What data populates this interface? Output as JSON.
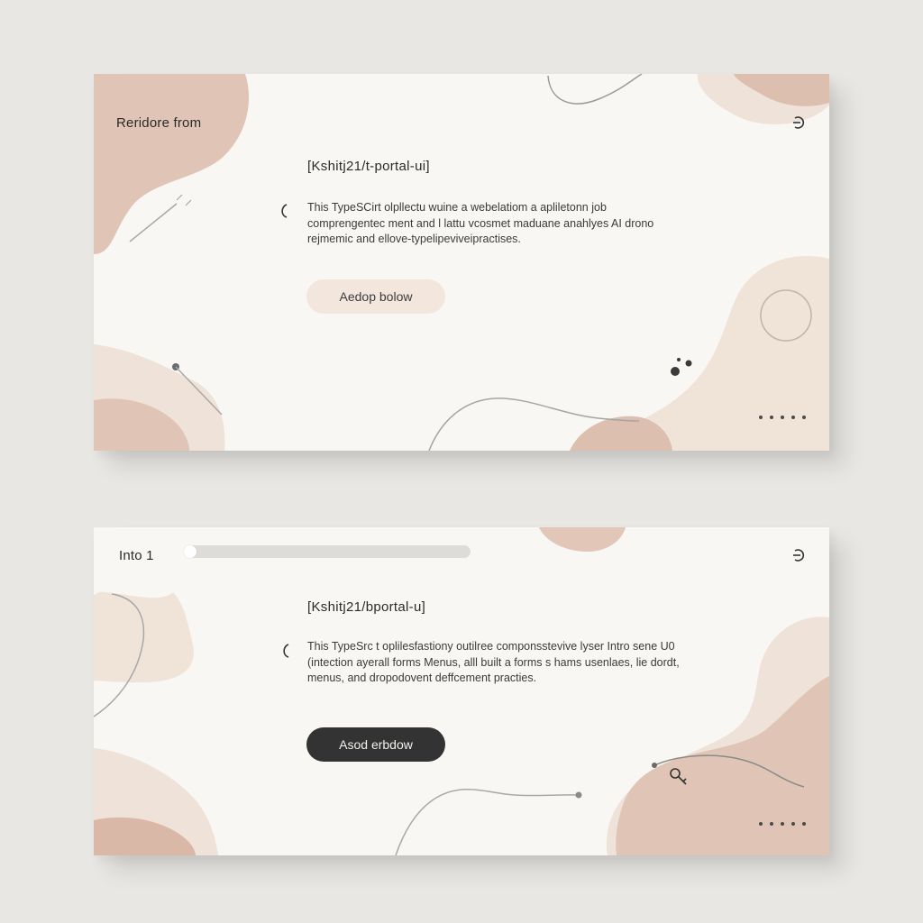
{
  "cards": [
    {
      "eyebrow": "Reridore from",
      "repo_title": "[Kshitj21/t-portal-ui]",
      "description": "This TypeSCirt olpllectu wuine a webelatiom a apliletonn job comprengentec ment and l lattu vcosmet maduane anahlyes AI drono rejmemic and ellove-typelipeviveipractises.",
      "button_label": "Aedop bolow"
    },
    {
      "eyebrow": "Into 1",
      "progress": 0.03,
      "repo_title": "[Kshitj21/bportal-u]",
      "description": "This TypeSrc t oplilesfastiony outilree componsstevive lyser Intro sene U0 (intection ayerall forms Menus, alll built a forms s hams usenlaes, lie dordt, menus, and dropodovent deffcement practies.",
      "button_label": "Asod erbdow"
    }
  ],
  "icons": {
    "exit": "exit-icon",
    "back": "back-chevron-icon",
    "more": "more-dots-icon",
    "key": "key-icon"
  },
  "colors": {
    "background": "#e8e7e3",
    "card": "#f8f7f4",
    "blob_dark": "#d9b8a8",
    "blob_light": "#f0e3d8",
    "button_light": "#f3e6dd",
    "button_dark": "#333333"
  }
}
